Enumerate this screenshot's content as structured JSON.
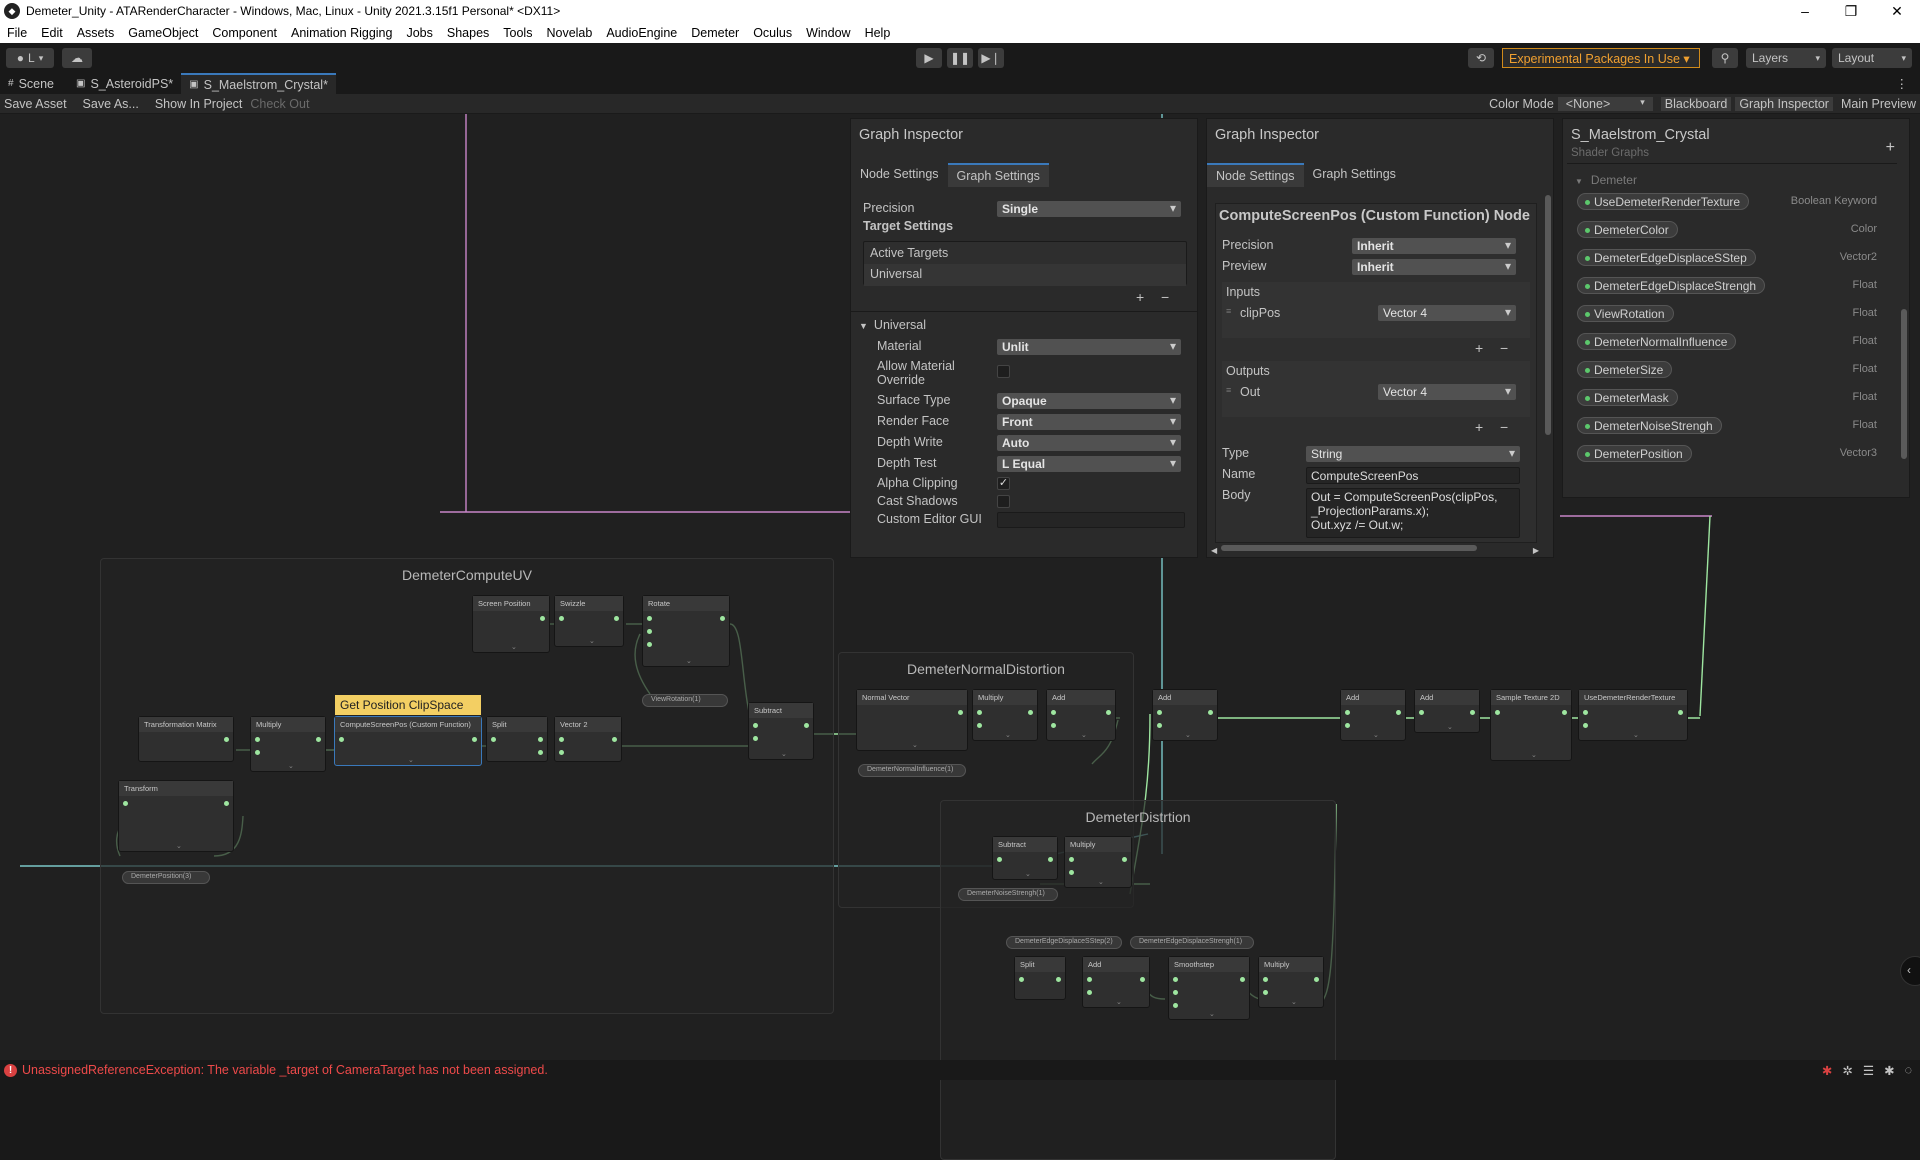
{
  "window": {
    "title": "Demeter_Unity - ATARenderCharacter - Windows, Mac, Linux - Unity 2021.3.15f1 Personal* <DX11>"
  },
  "menu": [
    "File",
    "Edit",
    "Assets",
    "GameObject",
    "Component",
    "Animation Rigging",
    "Jobs",
    "Shapes",
    "Tools",
    "Novelab",
    "AudioEngine",
    "Demeter",
    "Oculus",
    "Window",
    "Help"
  ],
  "toolbar": {
    "account_label": "L",
    "experimental": "Experimental Packages In Use ▾",
    "layers": "Layers",
    "layout": "Layout"
  },
  "tabs": [
    "Scene",
    "S_AsteroidPS*",
    "S_Maelstrom_Crystal*"
  ],
  "graph_toolbar": {
    "save_asset": "Save Asset",
    "save_as": "Save As...",
    "show_in_project": "Show In Project",
    "check_out": "Check Out",
    "color_mode_label": "Color Mode",
    "color_mode_value": "<None>",
    "blackboard": "Blackboard",
    "graph_inspector": "Graph Inspector",
    "main_preview": "Main Preview"
  },
  "inspector_left": {
    "title": "Graph Inspector",
    "tabs": [
      "Node Settings",
      "Graph Settings"
    ],
    "precision_label": "Precision",
    "precision_value": "Single",
    "target_settings": "Target Settings",
    "active_targets": "Active Targets",
    "universal_target": "Universal",
    "section": "Universal",
    "rows": [
      {
        "label": "Material",
        "value": "Unlit"
      },
      {
        "label": "Allow Material Override",
        "value": ""
      },
      {
        "label": "Surface Type",
        "value": "Opaque"
      },
      {
        "label": "Render Face",
        "value": "Front"
      },
      {
        "label": "Depth Write",
        "value": "Auto"
      },
      {
        "label": "Depth Test",
        "value": "L Equal"
      },
      {
        "label": "Alpha Clipping",
        "value": "✓"
      },
      {
        "label": "Cast Shadows",
        "value": ""
      },
      {
        "label": "Custom Editor GUI",
        "value": ""
      }
    ]
  },
  "inspector_right": {
    "title": "Graph Inspector",
    "tabs": [
      "Node Settings",
      "Graph Settings"
    ],
    "node_title": "ComputeScreenPos (Custom Function) Node",
    "precision_label": "Precision",
    "precision_value": "Inherit",
    "preview_label": "Preview",
    "preview_value": "Inherit",
    "inputs_label": "Inputs",
    "input_name": "clipPos",
    "input_type": "Vector 4",
    "outputs_label": "Outputs",
    "output_name": "Out",
    "output_type": "Vector 4",
    "type_label": "Type",
    "type_value": "String",
    "name_label": "Name",
    "name_value": "ComputeScreenPos",
    "body_label": "Body",
    "body_line1": "Out = ComputeScreenPos(clipPos,",
    "body_line2": "_ProjectionParams.x);",
    "body_line3": "Out.xyz /= Out.w;"
  },
  "blackboard": {
    "title": "S_Maelstrom_Crystal",
    "subtitle": "Shader Graphs",
    "category": "Demeter",
    "items": [
      {
        "name": "UseDemeterRenderTexture",
        "type": "Boolean Keyword"
      },
      {
        "name": "DemeterColor",
        "type": "Color"
      },
      {
        "name": "DemeterEdgeDisplaceSStep",
        "type": "Vector2"
      },
      {
        "name": "DemeterEdgeDisplaceStrengh",
        "type": "Float"
      },
      {
        "name": "ViewRotation",
        "type": "Float"
      },
      {
        "name": "DemeterNormalInfluence",
        "type": "Float"
      },
      {
        "name": "DemeterSize",
        "type": "Float"
      },
      {
        "name": "DemeterMask",
        "type": "Float"
      },
      {
        "name": "DemeterNoiseStrengh",
        "type": "Float"
      },
      {
        "name": "DemeterPosition",
        "type": "Vector3"
      }
    ]
  },
  "graph": {
    "groups": [
      "DemeterComputeUV",
      "DemeterNormalDistortion",
      "DemeterDistrtion"
    ],
    "sticky": "Get Position ClipSpace",
    "nodes": {
      "screen_position": "Screen Position",
      "swizzle": "Swizzle",
      "rotate": "Rotate",
      "transformation_matrix": "Transformation Matrix",
      "multiply": "Multiply",
      "compute_screen_pos": "ComputeScreenPos (Custom Function)",
      "split": "Split",
      "vector2": "Vector 2",
      "subtract": "Subtract",
      "transform": "Transform",
      "normal_vector": "Normal Vector",
      "add": "Add",
      "sample_texture": "Sample Texture 2D",
      "use_demeter_rt": "UseDemeterRenderTexture",
      "smoothstep": "Smoothstep"
    },
    "properties": {
      "view_rotation": "ViewRotation(1)",
      "demeter_position": "DemeterPosition(3)",
      "normal_influence": "DemeterNormalInfluence(1)",
      "noise_strength": "DemeterNoiseStrengh(1)",
      "edge_sstep": "DemeterEdgeDisplaceSStep(2)",
      "edge_strength": "DemeterEdgeDisplaceStrengh(1)"
    }
  },
  "status": {
    "error": "UnassignedReferenceException: The variable _target of CameraTarget has not been assigned."
  }
}
